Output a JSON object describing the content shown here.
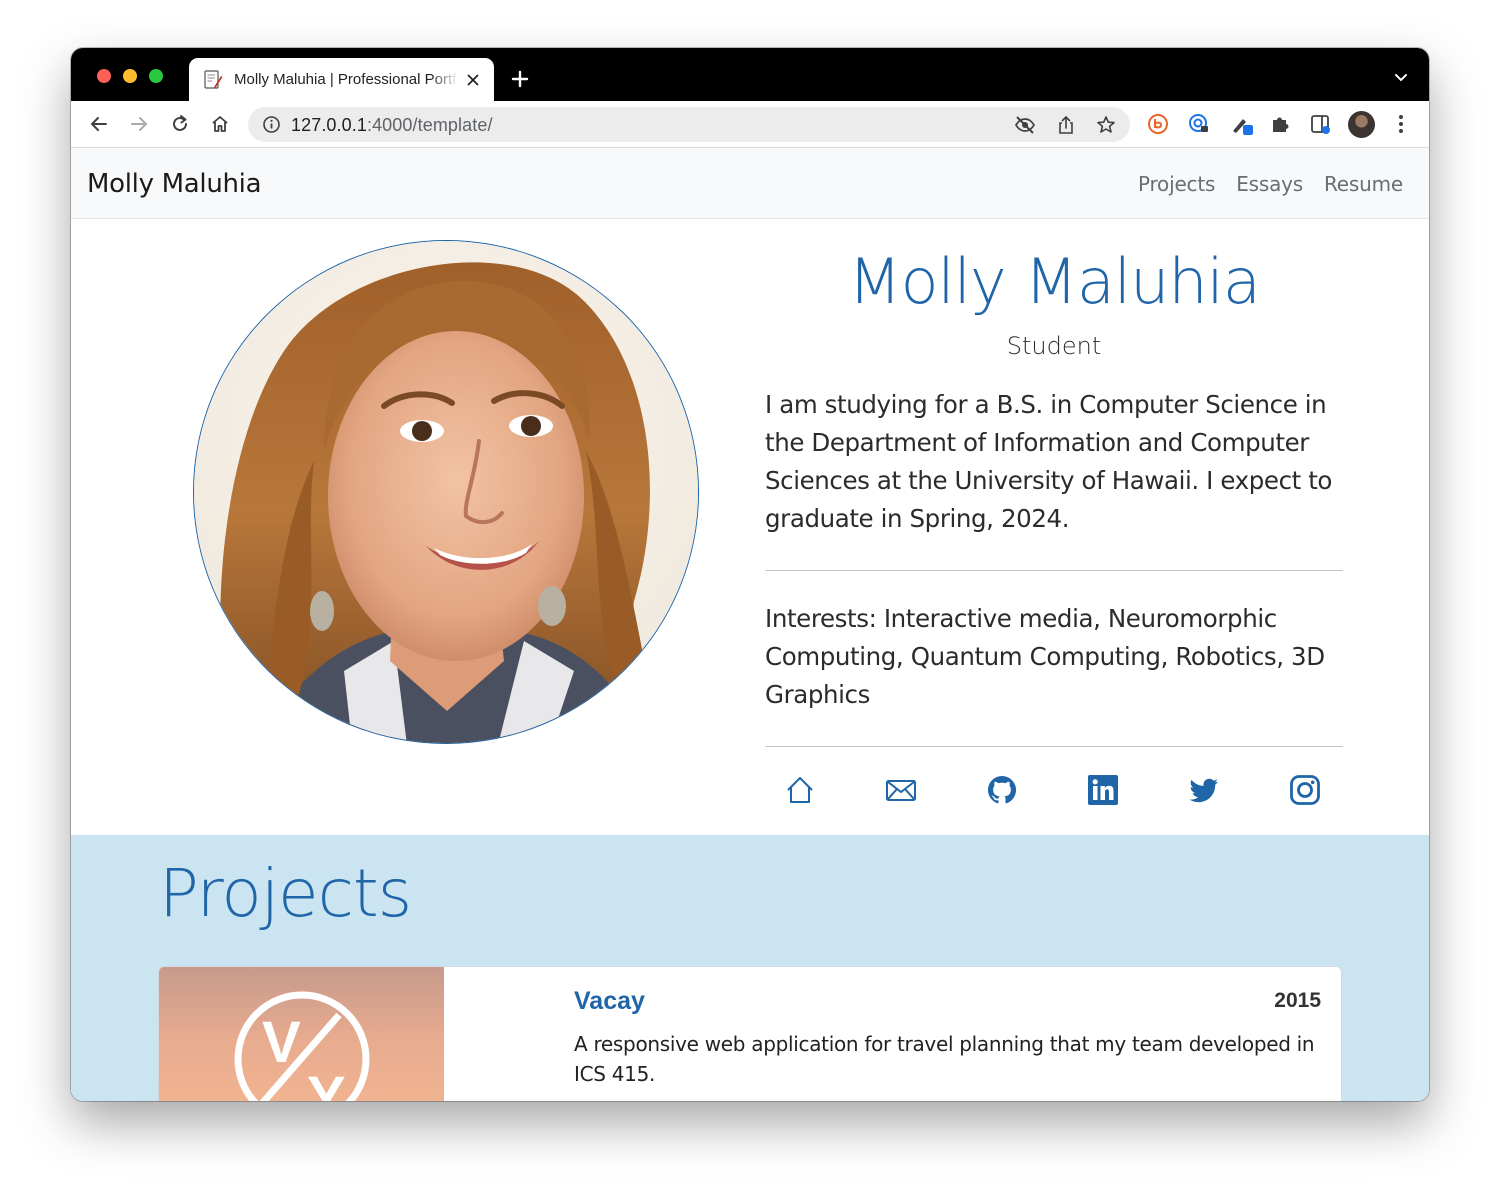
{
  "browser": {
    "tab_title": "Molly Maluhia | Professional Portfolio",
    "url_host": "127.0.0.1",
    "url_rest": ":4000/template/"
  },
  "navbar": {
    "brand": "Molly Maluhia",
    "links": [
      "Projects",
      "Essays",
      "Resume"
    ]
  },
  "hero": {
    "name": "Molly Maluhia",
    "role": "Student",
    "bio": "I am studying for a B.S. in Computer Science in the Department of Information and Computer Sciences at the University of Hawaii. I expect to graduate in Spring, 2024.",
    "interests": "Interests: Interactive media, Neuromorphic Computing, Quantum Computing, Robotics, 3D Graphics",
    "social_icons": [
      "home-icon",
      "mail-icon",
      "github-icon",
      "linkedin-icon",
      "twitter-icon",
      "instagram-icon"
    ]
  },
  "projects": {
    "heading": "Projects",
    "items": [
      {
        "title": "Vacay",
        "year": "2015",
        "description": "A responsive web application for travel planning that my team developed in ICS 415.",
        "logo_text": "V/Y"
      }
    ]
  },
  "colors": {
    "accent": "#1f65a8",
    "projects_bg": "#cae5f1",
    "navbar_bg": "#f8f9fa"
  }
}
